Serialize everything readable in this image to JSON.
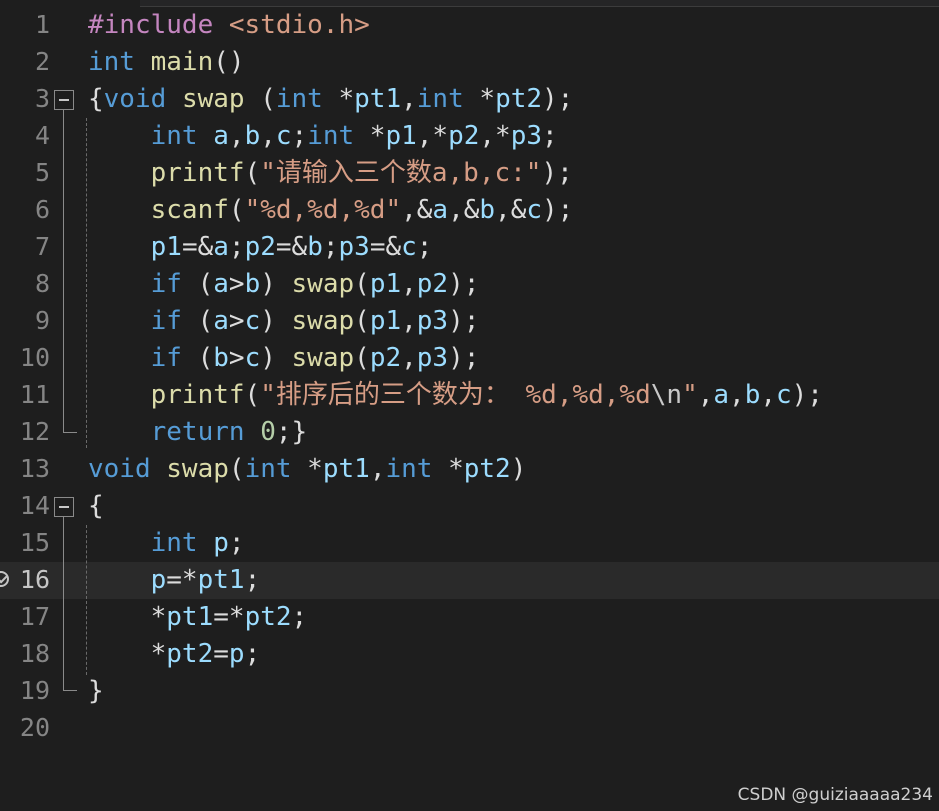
{
  "editor": {
    "current_line": 16,
    "lines": [
      {
        "number": "1",
        "tokens": [
          {
            "t": "#include ",
            "c": "pp"
          },
          {
            "t": "<stdio.h>",
            "c": "str"
          }
        ]
      },
      {
        "number": "2",
        "tokens": [
          {
            "t": "int",
            "c": "kw"
          },
          {
            "t": " ",
            "c": "op"
          },
          {
            "t": "main",
            "c": "fn"
          },
          {
            "t": "()",
            "c": "op"
          }
        ]
      },
      {
        "number": "3",
        "tokens": [
          {
            "t": "{",
            "c": "op"
          },
          {
            "t": "void",
            "c": "kw"
          },
          {
            "t": " ",
            "c": "op"
          },
          {
            "t": "swap",
            "c": "fn"
          },
          {
            "t": " (",
            "c": "op"
          },
          {
            "t": "int",
            "c": "kw"
          },
          {
            "t": " *",
            "c": "op"
          },
          {
            "t": "pt1",
            "c": "var"
          },
          {
            "t": ",",
            "c": "op"
          },
          {
            "t": "int",
            "c": "kw"
          },
          {
            "t": " *",
            "c": "op"
          },
          {
            "t": "pt2",
            "c": "var"
          },
          {
            "t": ");",
            "c": "op"
          }
        ]
      },
      {
        "number": "4",
        "tokens": [
          {
            "t": "    ",
            "c": "op"
          },
          {
            "t": "int",
            "c": "kw"
          },
          {
            "t": " ",
            "c": "op"
          },
          {
            "t": "a",
            "c": "var"
          },
          {
            "t": ",",
            "c": "op"
          },
          {
            "t": "b",
            "c": "var"
          },
          {
            "t": ",",
            "c": "op"
          },
          {
            "t": "c",
            "c": "var"
          },
          {
            "t": ";",
            "c": "op"
          },
          {
            "t": "int",
            "c": "kw"
          },
          {
            "t": " *",
            "c": "op"
          },
          {
            "t": "p1",
            "c": "var"
          },
          {
            "t": ",*",
            "c": "op"
          },
          {
            "t": "p2",
            "c": "var"
          },
          {
            "t": ",*",
            "c": "op"
          },
          {
            "t": "p3",
            "c": "var"
          },
          {
            "t": ";",
            "c": "op"
          }
        ]
      },
      {
        "number": "5",
        "tokens": [
          {
            "t": "    ",
            "c": "op"
          },
          {
            "t": "printf",
            "c": "fn"
          },
          {
            "t": "(",
            "c": "op"
          },
          {
            "t": "\"请输入三个数a,b,c:\"",
            "c": "str"
          },
          {
            "t": ");",
            "c": "op"
          }
        ]
      },
      {
        "number": "6",
        "tokens": [
          {
            "t": "    ",
            "c": "op"
          },
          {
            "t": "scanf",
            "c": "fn"
          },
          {
            "t": "(",
            "c": "op"
          },
          {
            "t": "\"%d,%d,%d\"",
            "c": "str"
          },
          {
            "t": ",&",
            "c": "op"
          },
          {
            "t": "a",
            "c": "var"
          },
          {
            "t": ",&",
            "c": "op"
          },
          {
            "t": "b",
            "c": "var"
          },
          {
            "t": ",&",
            "c": "op"
          },
          {
            "t": "c",
            "c": "var"
          },
          {
            "t": ");",
            "c": "op"
          }
        ]
      },
      {
        "number": "7",
        "tokens": [
          {
            "t": "    ",
            "c": "op"
          },
          {
            "t": "p1",
            "c": "var"
          },
          {
            "t": "=&",
            "c": "op"
          },
          {
            "t": "a",
            "c": "var"
          },
          {
            "t": ";",
            "c": "op"
          },
          {
            "t": "p2",
            "c": "var"
          },
          {
            "t": "=&",
            "c": "op"
          },
          {
            "t": "b",
            "c": "var"
          },
          {
            "t": ";",
            "c": "op"
          },
          {
            "t": "p3",
            "c": "var"
          },
          {
            "t": "=&",
            "c": "op"
          },
          {
            "t": "c",
            "c": "var"
          },
          {
            "t": ";",
            "c": "op"
          }
        ]
      },
      {
        "number": "8",
        "tokens": [
          {
            "t": "    ",
            "c": "op"
          },
          {
            "t": "if",
            "c": "kw"
          },
          {
            "t": " (",
            "c": "op"
          },
          {
            "t": "a",
            "c": "var"
          },
          {
            "t": ">",
            "c": "op"
          },
          {
            "t": "b",
            "c": "var"
          },
          {
            "t": ") ",
            "c": "op"
          },
          {
            "t": "swap",
            "c": "fn"
          },
          {
            "t": "(",
            "c": "op"
          },
          {
            "t": "p1",
            "c": "var"
          },
          {
            "t": ",",
            "c": "op"
          },
          {
            "t": "p2",
            "c": "var"
          },
          {
            "t": ");",
            "c": "op"
          }
        ]
      },
      {
        "number": "9",
        "tokens": [
          {
            "t": "    ",
            "c": "op"
          },
          {
            "t": "if",
            "c": "kw"
          },
          {
            "t": " (",
            "c": "op"
          },
          {
            "t": "a",
            "c": "var"
          },
          {
            "t": ">",
            "c": "op"
          },
          {
            "t": "c",
            "c": "var"
          },
          {
            "t": ") ",
            "c": "op"
          },
          {
            "t": "swap",
            "c": "fn"
          },
          {
            "t": "(",
            "c": "op"
          },
          {
            "t": "p1",
            "c": "var"
          },
          {
            "t": ",",
            "c": "op"
          },
          {
            "t": "p3",
            "c": "var"
          },
          {
            "t": ");",
            "c": "op"
          }
        ]
      },
      {
        "number": "10",
        "tokens": [
          {
            "t": "    ",
            "c": "op"
          },
          {
            "t": "if",
            "c": "kw"
          },
          {
            "t": " (",
            "c": "op"
          },
          {
            "t": "b",
            "c": "var"
          },
          {
            "t": ">",
            "c": "op"
          },
          {
            "t": "c",
            "c": "var"
          },
          {
            "t": ") ",
            "c": "op"
          },
          {
            "t": "swap",
            "c": "fn"
          },
          {
            "t": "(",
            "c": "op"
          },
          {
            "t": "p2",
            "c": "var"
          },
          {
            "t": ",",
            "c": "op"
          },
          {
            "t": "p3",
            "c": "var"
          },
          {
            "t": ");",
            "c": "op"
          }
        ]
      },
      {
        "number": "11",
        "tokens": [
          {
            "t": "    ",
            "c": "op"
          },
          {
            "t": "printf",
            "c": "fn"
          },
          {
            "t": "(",
            "c": "op"
          },
          {
            "t": "\"排序后的三个数为： %d,%d,%d",
            "c": "str"
          },
          {
            "t": "\\n",
            "c": "esc"
          },
          {
            "t": "\"",
            "c": "str"
          },
          {
            "t": ",",
            "c": "op"
          },
          {
            "t": "a",
            "c": "var"
          },
          {
            "t": ",",
            "c": "op"
          },
          {
            "t": "b",
            "c": "var"
          },
          {
            "t": ",",
            "c": "op"
          },
          {
            "t": "c",
            "c": "var"
          },
          {
            "t": ");",
            "c": "op"
          }
        ]
      },
      {
        "number": "12",
        "tokens": [
          {
            "t": "    ",
            "c": "op"
          },
          {
            "t": "return",
            "c": "kw"
          },
          {
            "t": " ",
            "c": "op"
          },
          {
            "t": "0",
            "c": "num"
          },
          {
            "t": ";}",
            "c": "op"
          }
        ]
      },
      {
        "number": "13",
        "tokens": [
          {
            "t": "void",
            "c": "kw"
          },
          {
            "t": " ",
            "c": "op"
          },
          {
            "t": "swap",
            "c": "fn"
          },
          {
            "t": "(",
            "c": "op"
          },
          {
            "t": "int",
            "c": "kw"
          },
          {
            "t": " *",
            "c": "op"
          },
          {
            "t": "pt1",
            "c": "var"
          },
          {
            "t": ",",
            "c": "op"
          },
          {
            "t": "int",
            "c": "kw"
          },
          {
            "t": " *",
            "c": "op"
          },
          {
            "t": "pt2",
            "c": "var"
          },
          {
            "t": ")",
            "c": "op"
          }
        ]
      },
      {
        "number": "14",
        "tokens": [
          {
            "t": "{",
            "c": "op"
          }
        ]
      },
      {
        "number": "15",
        "tokens": [
          {
            "t": "    ",
            "c": "op"
          },
          {
            "t": "int",
            "c": "kw"
          },
          {
            "t": " ",
            "c": "op"
          },
          {
            "t": "p",
            "c": "var"
          },
          {
            "t": ";",
            "c": "op"
          }
        ]
      },
      {
        "number": "16",
        "tokens": [
          {
            "t": "    ",
            "c": "op"
          },
          {
            "t": "p",
            "c": "var"
          },
          {
            "t": "=*",
            "c": "op"
          },
          {
            "t": "pt1",
            "c": "var"
          },
          {
            "t": ";",
            "c": "op"
          }
        ]
      },
      {
        "number": "17",
        "tokens": [
          {
            "t": "    *",
            "c": "op"
          },
          {
            "t": "pt1",
            "c": "var"
          },
          {
            "t": "=*",
            "c": "op"
          },
          {
            "t": "pt2",
            "c": "var"
          },
          {
            "t": ";",
            "c": "op"
          }
        ]
      },
      {
        "number": "18",
        "tokens": [
          {
            "t": "    *",
            "c": "op"
          },
          {
            "t": "pt2",
            "c": "var"
          },
          {
            "t": "=",
            "c": "op"
          },
          {
            "t": "p",
            "c": "var"
          },
          {
            "t": ";",
            "c": "op"
          }
        ]
      },
      {
        "number": "19",
        "tokens": [
          {
            "t": "}",
            "c": "op"
          }
        ]
      },
      {
        "number": "20",
        "tokens": []
      }
    ]
  },
  "gutter": {
    "breakpoint_icon": "breakpoint-check-icon",
    "fold_icon": "collapse-minus-icon"
  },
  "watermark": "CSDN @guiziaaaaa234",
  "colors": {
    "background": "#1e1e1e",
    "keyword": "#569cd6",
    "preprocessor": "#c586c0",
    "function": "#dcdcaa",
    "string": "#d69d85",
    "variable": "#9cdcfe",
    "number": "#b5cea8"
  }
}
